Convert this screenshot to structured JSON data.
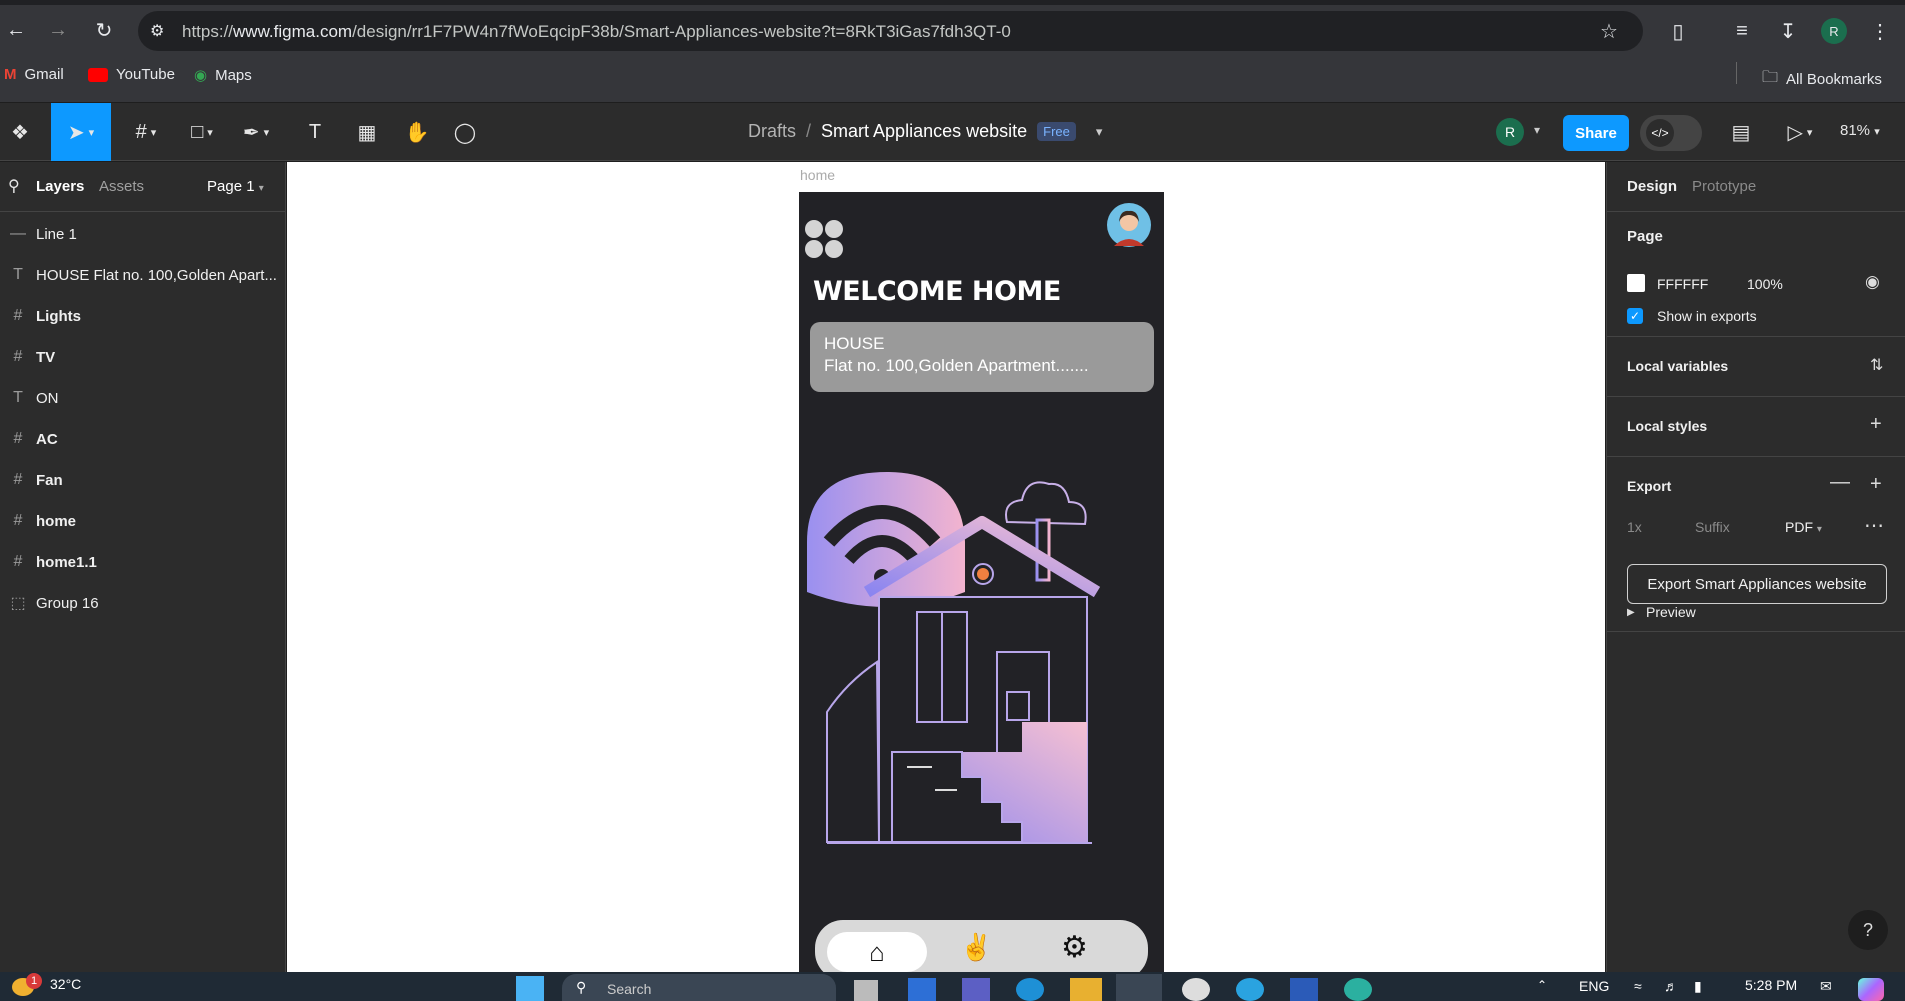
{
  "browser": {
    "url_prefix": "https://",
    "url_host": "www.figma.com",
    "url_path": "/design/rr1F7PW4n7fWoEqcipF38b/Smart-Appliances-website?t=8RkT3iGas7fdh3QT-0",
    "profile_initial": "R",
    "bookmarks": [
      "Gmail",
      "YouTube",
      "Maps"
    ],
    "all_bookmarks": "All Bookmarks"
  },
  "figma": {
    "breadcrumb_parent": "Drafts",
    "separator": "/",
    "file_name": "Smart Appliances website",
    "plan_badge": "Free",
    "user_initial": "R",
    "share_label": "Share",
    "zoom": "81%"
  },
  "left_panel": {
    "tabs": [
      "Layers",
      "Assets"
    ],
    "page_selector": "Page 1",
    "layers": [
      {
        "name": "Line 1",
        "icon": "line-icon",
        "bold": false
      },
      {
        "name": "HOUSE Flat no. 100,Golden Apart...",
        "icon": "text-icon",
        "bold": false
      },
      {
        "name": "Lights",
        "icon": "frame-icon",
        "bold": true
      },
      {
        "name": "TV",
        "icon": "frame-icon",
        "bold": true
      },
      {
        "name": "ON",
        "icon": "text-icon",
        "bold": false
      },
      {
        "name": "AC",
        "icon": "frame-icon",
        "bold": true
      },
      {
        "name": "Fan",
        "icon": "frame-icon",
        "bold": true
      },
      {
        "name": "home",
        "icon": "frame-icon",
        "bold": true
      },
      {
        "name": "home1.1",
        "icon": "frame-icon",
        "bold": true
      },
      {
        "name": "Group 16",
        "icon": "group-icon",
        "bold": false
      }
    ]
  },
  "canvas": {
    "frame_label": "home",
    "phone": {
      "welcome": "WELCOME HOME",
      "address_line1": "HOUSE",
      "address_line2": "Flat no. 100,Golden Apartment.......",
      "nav_icons": [
        "home-icon",
        "hand-tap-icon",
        "gear-icon"
      ]
    }
  },
  "right_panel": {
    "tabs": [
      "Design",
      "Prototype"
    ],
    "page_title": "Page",
    "page_color": "FFFFFF",
    "page_opacity": "100%",
    "show_in_exports": "Show in exports",
    "local_variables": "Local variables",
    "local_styles": "Local styles",
    "export_title": "Export",
    "export_scale": "1x",
    "export_suffix": "Suffix",
    "export_format": "PDF",
    "export_button": "Export Smart Appliances website",
    "preview": "Preview",
    "help": "?"
  },
  "taskbar": {
    "weather_temp": "32°C",
    "weather_badge": "1",
    "search": "Search",
    "lang": "ENG",
    "time": "5:28 PM"
  },
  "colors": {
    "accent": "#0d99ff",
    "phone_bg": "#222226",
    "card_bg": "#9a9a9a"
  }
}
